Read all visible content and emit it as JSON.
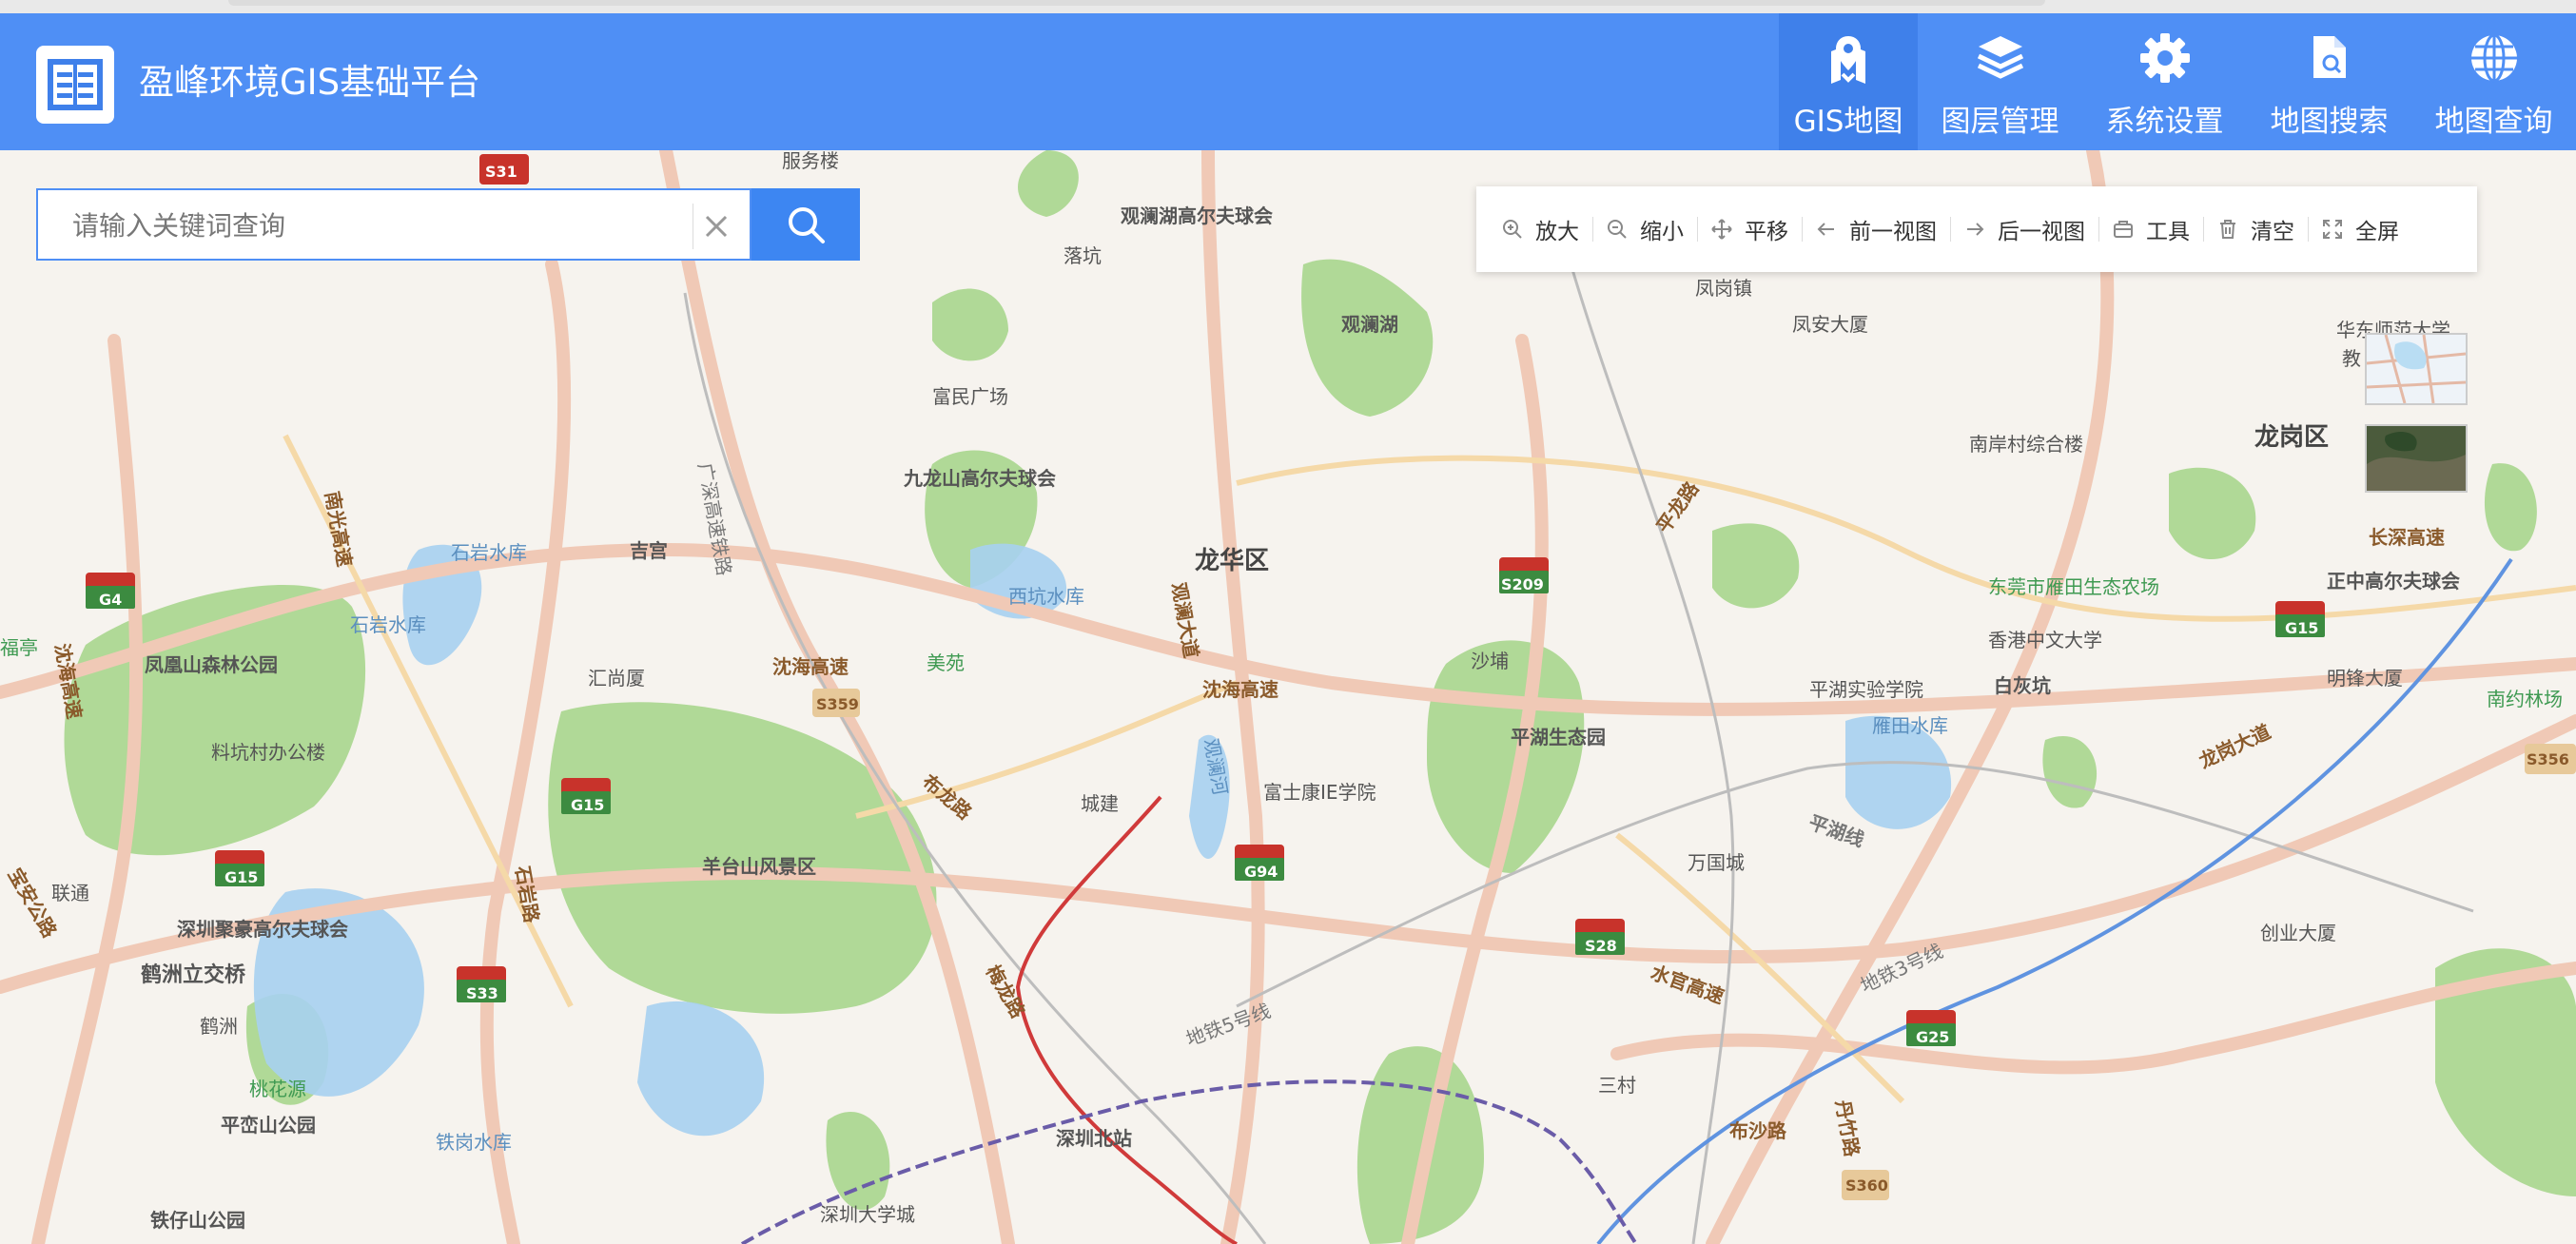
{
  "app": {
    "title": "盈峰环境GIS基础平台"
  },
  "nav": [
    {
      "label": "GIS地图",
      "icon": "map-pin-icon",
      "active": true
    },
    {
      "label": "图层管理",
      "icon": "layers-icon",
      "active": false
    },
    {
      "label": "系统设置",
      "icon": "gear-icon",
      "active": false
    },
    {
      "label": "地图搜索",
      "icon": "document-search-icon",
      "active": false
    },
    {
      "label": "地图查询",
      "icon": "globe-icon",
      "active": false
    }
  ],
  "search": {
    "placeholder": "请输入关键词查询",
    "value": ""
  },
  "toolbar": [
    {
      "label": "放大",
      "icon": "zoom-in-icon"
    },
    {
      "label": "缩小",
      "icon": "zoom-out-icon"
    },
    {
      "label": "平移",
      "icon": "pan-icon"
    },
    {
      "label": "前一视图",
      "icon": "arrow-left-icon"
    },
    {
      "label": "后一视图",
      "icon": "arrow-right-icon"
    },
    {
      "label": "工具",
      "icon": "toolbox-icon"
    },
    {
      "label": "清空",
      "icon": "trash-icon"
    },
    {
      "label": "全屏",
      "icon": "fullscreen-icon"
    }
  ],
  "map_labels": {
    "districts": [
      "龙华区",
      "龙岗区"
    ],
    "places": [
      "观澜湖高尔夫球会",
      "落坑",
      "观澜湖",
      "凤岗镇",
      "凤安大厦",
      "富民广场",
      "九龙山高尔夫球会",
      "石岩水库",
      "吉宫",
      "西坑水库",
      "南岸村综合楼",
      "华东师范大学",
      "教",
      "东莞市雁田生态农场",
      "正中高尔夫球会",
      "香港中文大学",
      "白灰坑",
      "平湖实验学院",
      "雁田水库",
      "明锋大厦",
      "南约林场",
      "凤凰山森林公园",
      "石岩水库",
      "汇尚厦",
      "美苑",
      "沙埔",
      "平湖生态园",
      "料坑村办公楼",
      "富士康IE学院",
      "城建",
      "万国城",
      "羊台山风景区",
      "深圳聚豪高尔夫球会",
      "鹤洲立交桥",
      "鹤洲",
      "创业大厦",
      "三村",
      "桃花源",
      "平峦山公园",
      "铁岗水库",
      "深圳北站",
      "深圳大学城",
      "铁仔山公园",
      "联通",
      "福亭",
      "服务楼"
    ],
    "roads": [
      "沈海高速",
      "沈海高速",
      "长深高速",
      "布龙路",
      "梅龙路",
      "观澜大道",
      "水官高速",
      "布沙路",
      "丹竹路",
      "平湖线",
      "地铁5号线",
      "地铁3号线",
      "龙岗大道",
      "石岩路",
      "南光高速",
      "广深高速铁路",
      "沈海高速",
      "平龙路",
      "宝安公路",
      "观澜河"
    ],
    "shields": [
      "S31",
      "G4",
      "S359",
      "G15",
      "G15",
      "S33",
      "G94",
      "S209",
      "S28",
      "G15",
      "G25",
      "S356",
      "S360"
    ]
  }
}
